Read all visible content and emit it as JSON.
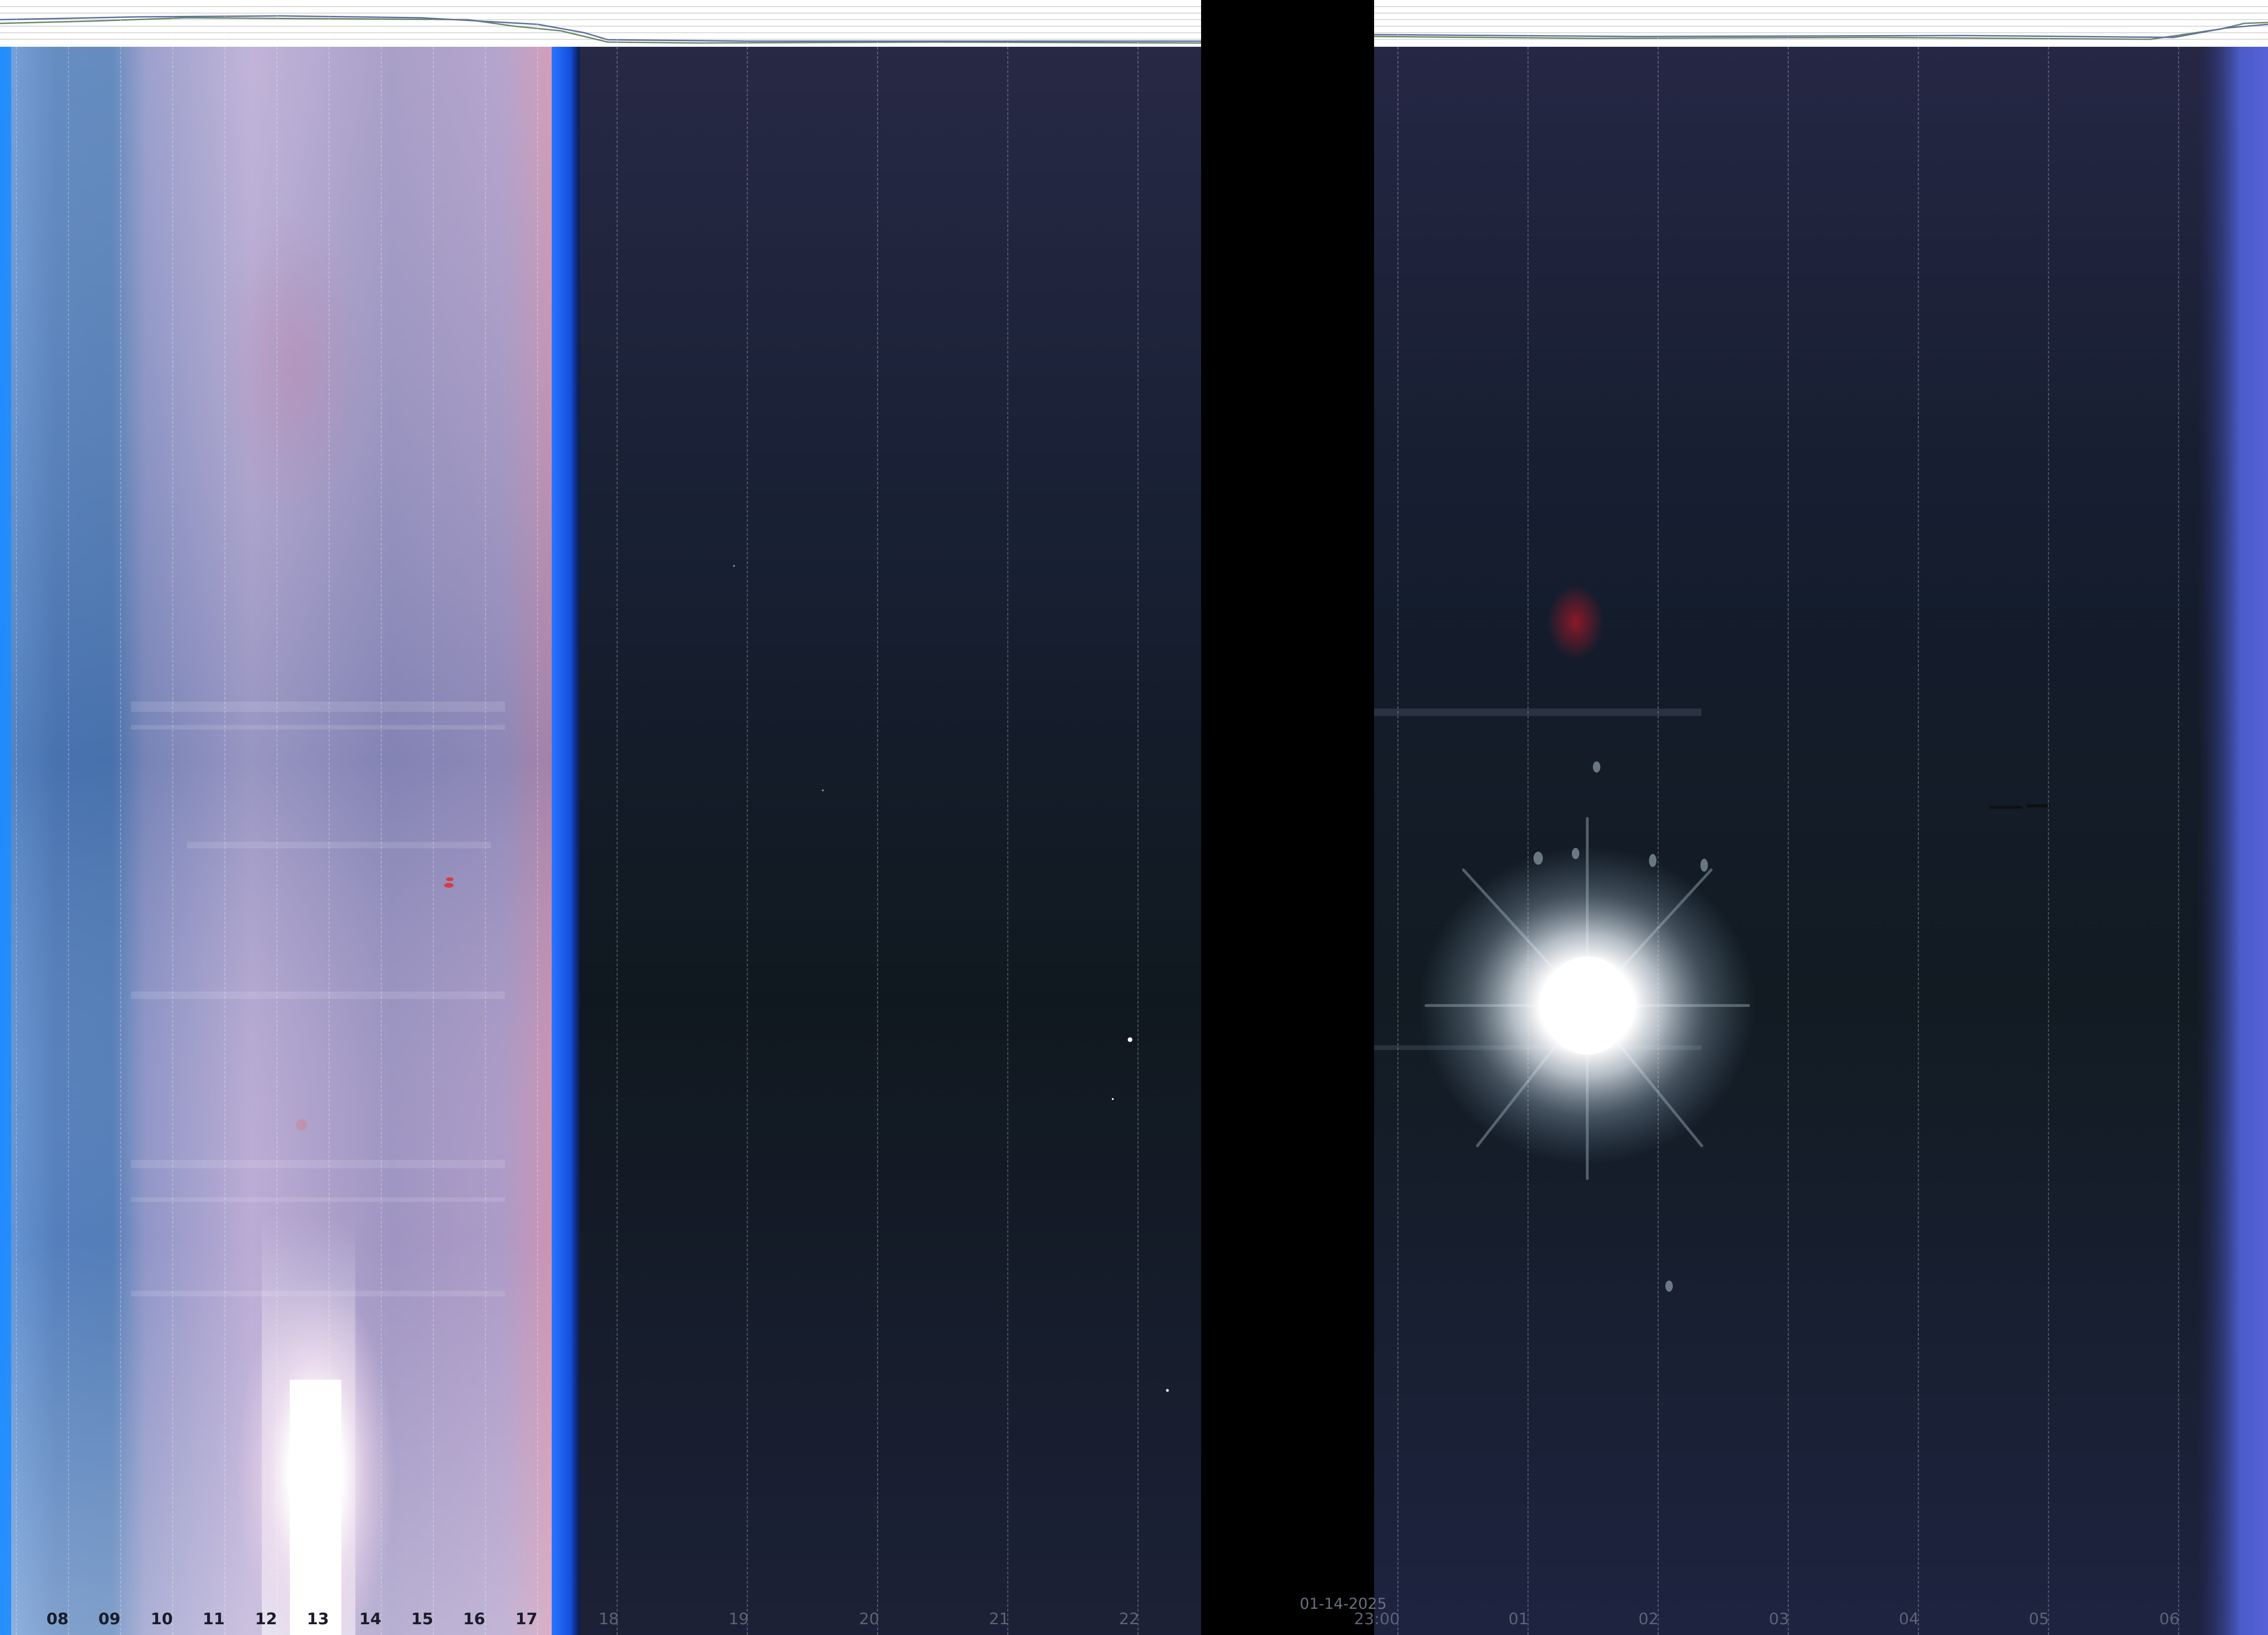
{
  "date_label": "01-14-2025",
  "hour_labels_day": [
    "08",
    "09",
    "10",
    "11",
    "12",
    "13",
    "14",
    "15",
    "16",
    "17"
  ],
  "hour_labels_evening": [
    "18",
    "19",
    "20",
    "21",
    "22"
  ],
  "hour_labels_night": [
    "23:00",
    "01",
    "02",
    "03",
    "04",
    "05",
    "06"
  ],
  "colors": {
    "sky_day_blue": "#4f7fc0",
    "sky_day_lavender": "#a99cc8",
    "sky_night": "#141c2b",
    "edge_blue": "#1f6bff",
    "gap_black": "#000000",
    "strip_white": "#ffffff"
  },
  "elements": {
    "sun_glare": "sun-glare",
    "moon": "moon-glare"
  }
}
